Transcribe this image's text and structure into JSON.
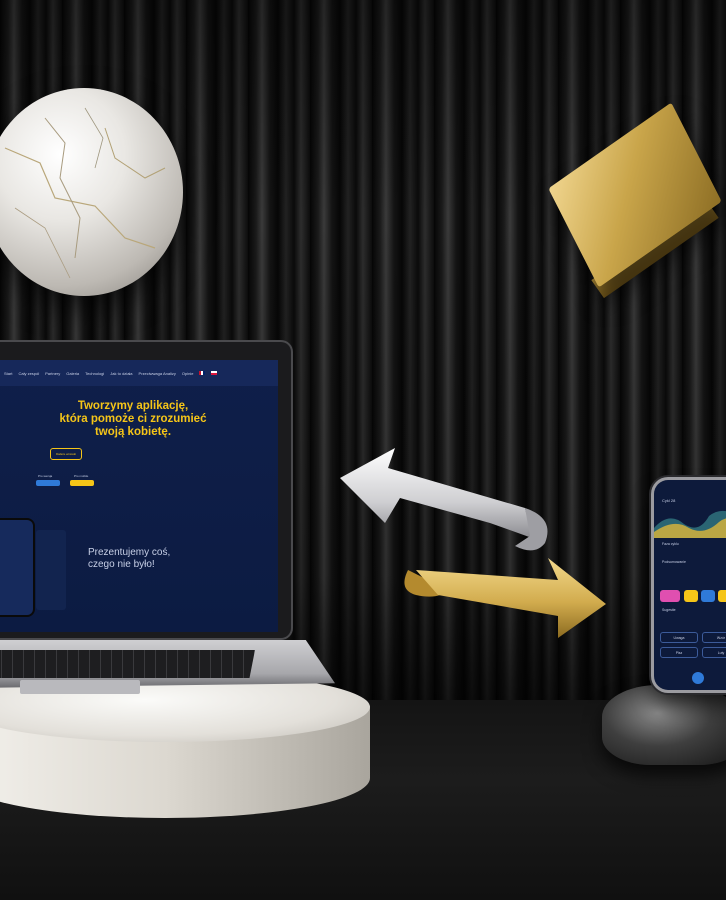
{
  "scene": {
    "background_color": "#0b0b0b",
    "accent_gold": "#c9a54a",
    "site_navy": "#0f1f4a",
    "site_yellow": "#f5c518"
  },
  "laptop_site": {
    "nav_items": [
      "Start",
      "Cały zespół",
      "Partnery",
      "Galeria",
      "Technologi",
      "Jak to działa",
      "Przeciwwaga Analizy",
      "Opinie"
    ],
    "hero_title_line1": "Tworzymy aplikację,",
    "hero_title_line2": "która pomoże ci zrozumieć",
    "hero_title_line3": "twoją kobietę.",
    "hero_button": "Dalsze wnioski",
    "store_label_1": "Pro wersja",
    "store_label_2": "Pro mobile",
    "present_text": "Prezentujemy coś, czego nie było!"
  },
  "phone_app": {
    "header": "Cykl 28",
    "label_1": "Faza cyklu",
    "label_2": "Podsumowanie",
    "label_3": "Sugestie",
    "btn_1": "Uwaga",
    "btn_2": "Wzór",
    "btn_3": "Pisz",
    "btn_4": "Luty"
  }
}
